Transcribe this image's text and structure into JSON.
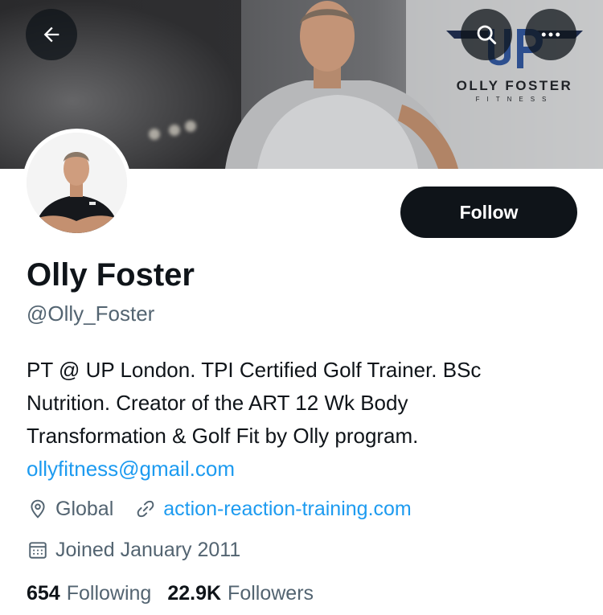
{
  "header": {
    "back_icon": "arrow-left-icon",
    "search_icon": "search-icon",
    "more_icon": "more-horizontal-icon",
    "banner_brand_name": "OLLY FOSTER",
    "banner_brand_sub": "FITNESS"
  },
  "profile": {
    "follow_label": "Follow",
    "display_name": "Olly Foster",
    "handle": "@Olly_Foster",
    "bio_lines": [
      "PT @ UP London. TPI Certified Golf Trainer. BSc",
      "Nutrition. Creator of the ART 12 Wk Body",
      "Transformation & Golf Fit by Olly program."
    ],
    "bio_email": "ollyfitness@gmail.com",
    "location": "Global",
    "website": "action-reaction-training.com",
    "joined": "Joined January 2011",
    "following_count": "654",
    "following_label": "Following",
    "followers_count": "22.9K",
    "followers_label": "Followers"
  },
  "colors": {
    "accent": "#1d9bf0",
    "text_primary": "#0f1419",
    "text_secondary": "#536471"
  }
}
